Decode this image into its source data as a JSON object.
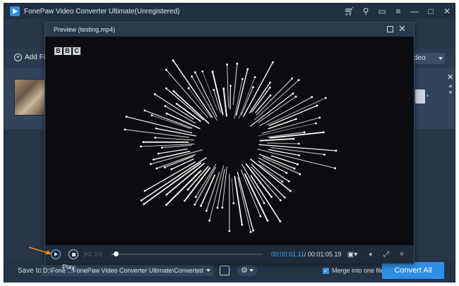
{
  "app": {
    "title": "FonePaw Video Converter Ultimate(Unregistered)",
    "icons": [
      "cart-icon",
      "key-icon",
      "chat-icon",
      "menu-icon",
      "minimize-icon",
      "maximize-icon",
      "close-icon"
    ]
  },
  "toolbar": {
    "add_files": "Add File",
    "format_value": "deo"
  },
  "preview": {
    "title": "Preview (testing.mp4)",
    "watermark": [
      "B",
      "B",
      "C"
    ],
    "current_time": "00:00:01.11",
    "total_time": "/ 00:01:05.19",
    "progress": 0.03,
    "play_tooltip": "Play"
  },
  "bottom": {
    "save_to_label": "Save to:",
    "path_value": "D:\\Fone   ...FonePaw Video Converter Ultimate\\Converted",
    "merge_label": "Merge into one file",
    "merge_checked": true,
    "convert_all": "Convert All"
  },
  "colors": {
    "accent": "#2f8fe8",
    "window_bg": "#283648",
    "video_bg": "#0c0c10",
    "annotation_arrow": "#f28a1c"
  }
}
